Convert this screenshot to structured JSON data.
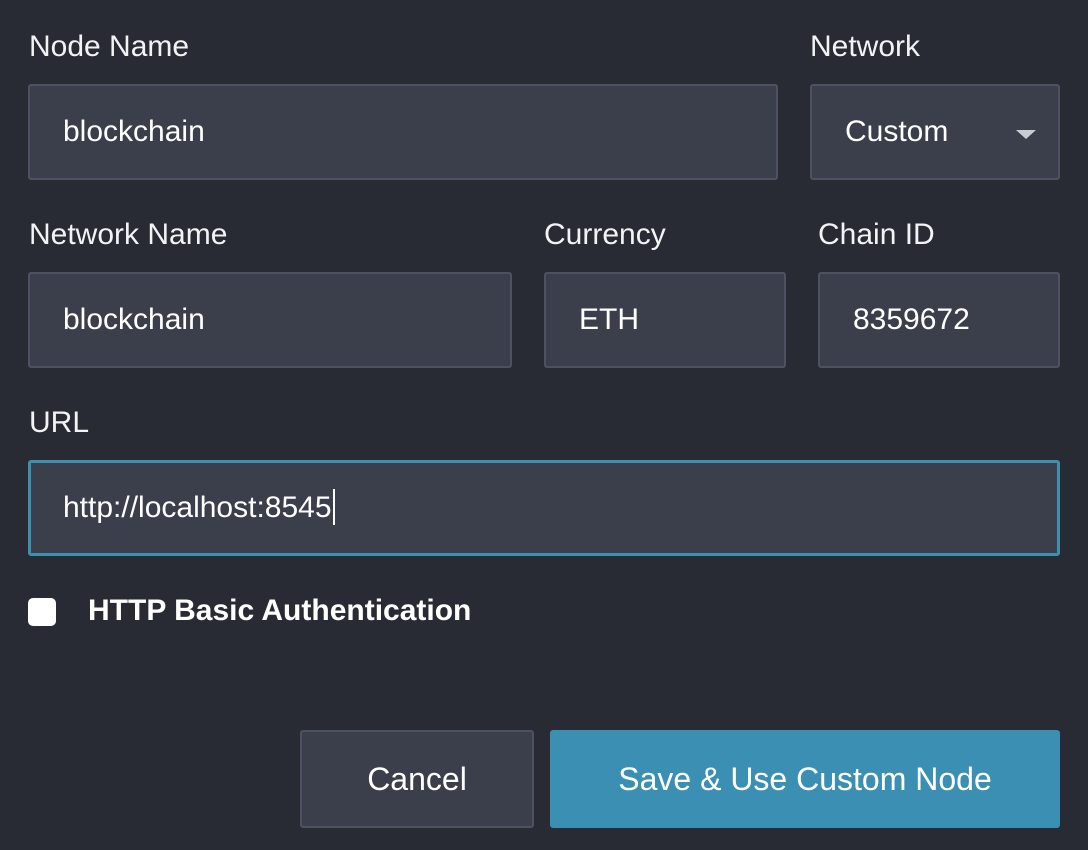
{
  "form": {
    "node_name": {
      "label": "Node Name",
      "value": "blockchain"
    },
    "network": {
      "label": "Network",
      "value": "Custom"
    },
    "network_name": {
      "label": "Network Name",
      "value": "blockchain"
    },
    "currency": {
      "label": "Currency",
      "value": "ETH"
    },
    "chain_id": {
      "label": "Chain ID",
      "value": "8359672"
    },
    "url": {
      "label": "URL",
      "value": "http://localhost:8545"
    },
    "http_auth": {
      "label": "HTTP Basic Authentication",
      "checked": false
    }
  },
  "actions": {
    "cancel_label": "Cancel",
    "save_label": "Save & Use Custom Node"
  },
  "colors": {
    "background": "#282b34",
    "field_background": "#3b3f4b",
    "field_border": "#4e5260",
    "focus_border": "#3e8fb0",
    "primary_button": "#3a8fb3"
  },
  "icons": {
    "network_dropdown": "chevron-down-icon"
  }
}
